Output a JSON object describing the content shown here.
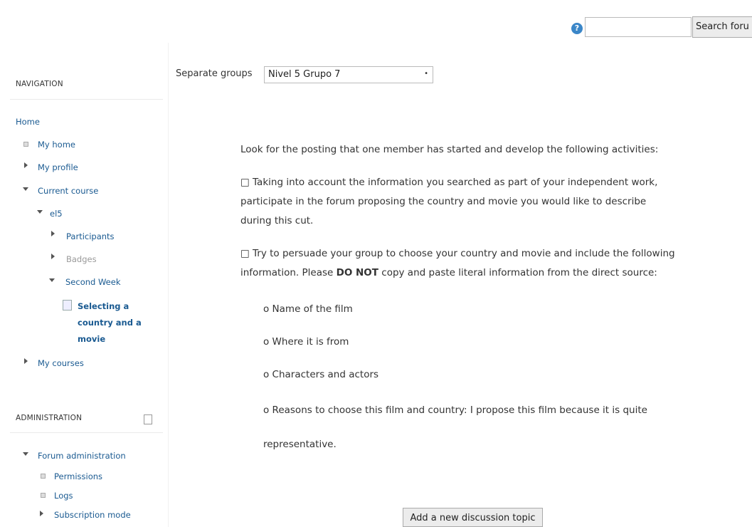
{
  "search": {
    "button_label": "Search foru",
    "value": ""
  },
  "navigation": {
    "title": "NAVIGATION",
    "home": "Home",
    "my_home": "My home",
    "my_profile": "My profile",
    "current_course": "Current course",
    "course": "el5",
    "participants": "Participants",
    "badges": "Badges",
    "second_week": "Second Week",
    "activity_line1": "Selecting a",
    "activity_line2": "country and a",
    "activity_line3": "movie",
    "my_courses": "My courses"
  },
  "administration": {
    "title": "ADMINISTRATION",
    "forum_admin": "Forum administration",
    "permissions": "Permissions",
    "logs": "Logs",
    "subscription_mode": "Subscription mode"
  },
  "groups": {
    "label": "Separate groups",
    "selected": "Nivel 5 Grupo 7"
  },
  "intro": {
    "p1": "Look for the posting that one member has started and develop the following activities:",
    "p2_line1": "□ Taking into account the information you searched as part of your independent work,",
    "p2_line2": "participate in the forum proposing the country and movie you would like to describe",
    "p2_line3": "during this cut.",
    "p3_line1": "□ Try to persuade your group to choose your country and movie and include the following",
    "p3_line2_a": "information. Please ",
    "p3_line2_b": "DO NOT",
    "p3_line2_c": " copy and paste literal information from the direct source:",
    "item1": "o Name of the film",
    "item2": "o Where it is from",
    "item3": "o Characters and actors",
    "item4": "o Reasons to choose this film and country: I propose this film because it is quite",
    "item4_cont": "representative."
  },
  "add_topic_label": "Add a new discussion topic"
}
